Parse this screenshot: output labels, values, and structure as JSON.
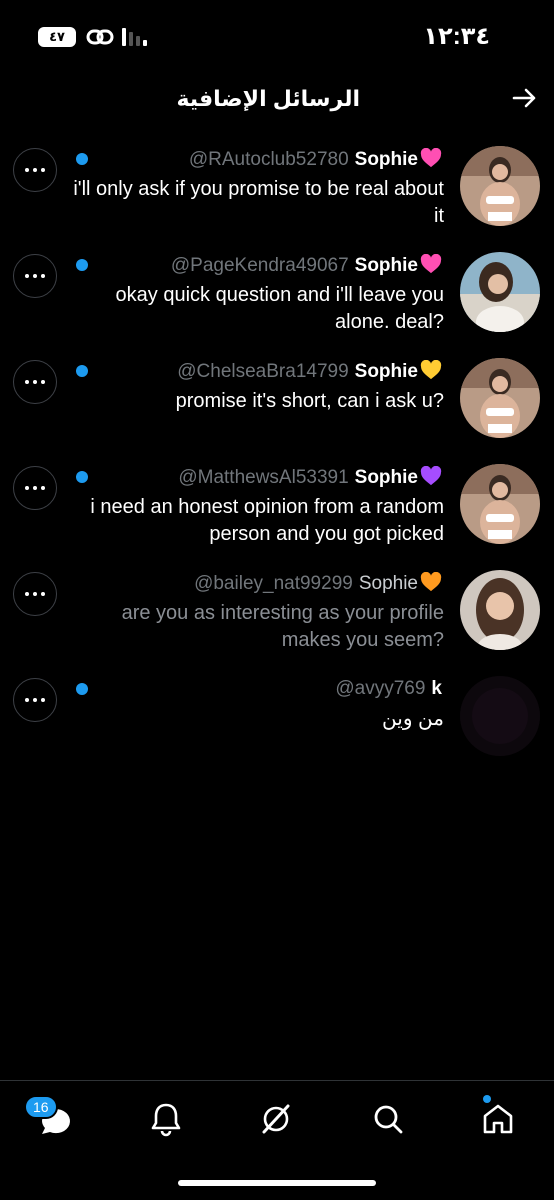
{
  "status_bar": {
    "time": "١٢:٣٤",
    "battery": "٤٧"
  },
  "header": {
    "title": "الرسائل الإضافية"
  },
  "messages": [
    {
      "handle": "@RAutoclub52780",
      "name": "Sophie",
      "emoji": "pink-heart",
      "text": "i'll only ask if you promise to be real about it",
      "unread": true
    },
    {
      "handle": "@PageKendra49067",
      "name": "Sophie",
      "emoji": "pink-heart",
      "text": "okay quick question and i'll leave you alone. deal?",
      "unread": true
    },
    {
      "handle": "@ChelseaBra14799",
      "name": "Sophie",
      "emoji": "yellow-heart",
      "text": "promise it's short, can i ask u?",
      "unread": true
    },
    {
      "handle": "@MatthewsAl53391",
      "name": "Sophie",
      "emoji": "purple-heart",
      "text": "i need an honest opinion from a random person and you got picked",
      "unread": true
    },
    {
      "handle": "@bailey_nat99299",
      "name": "Sophie",
      "emoji": "orange-heart",
      "text": "are you as interesting as your profile makes you seem?",
      "unread": false
    },
    {
      "handle": "@avyy769",
      "name": "k",
      "emoji": "",
      "text": "من وين",
      "unread": true
    }
  ],
  "bottom_nav": {
    "messages_badge": "16",
    "items": [
      "messages-icon",
      "notifications-bell-icon",
      "grok-icon",
      "search-icon",
      "home-icon"
    ]
  },
  "colors": {
    "accent": "#1d9bf0",
    "background": "#000000",
    "muted": "#71767b"
  }
}
